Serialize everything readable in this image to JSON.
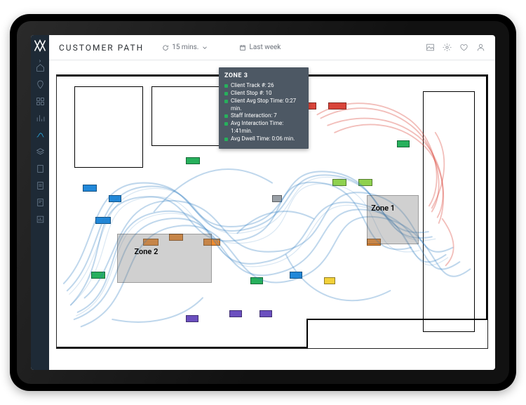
{
  "header": {
    "title": "CUSTOMER PATH",
    "refresh_rate": "15 mins.",
    "date_range": "Last week"
  },
  "sidebar": {
    "items": [
      {
        "name": "home-icon"
      },
      {
        "name": "pin-icon"
      },
      {
        "name": "grid-icon"
      },
      {
        "name": "chart-icon"
      },
      {
        "name": "path-icon",
        "active": true
      },
      {
        "name": "layers-icon"
      },
      {
        "name": "doc-icon"
      },
      {
        "name": "doc2-icon"
      },
      {
        "name": "doc3-icon"
      },
      {
        "name": "report-icon"
      }
    ]
  },
  "tooltip": {
    "title": "ZONE 3",
    "lines": [
      {
        "label": "Client Track #",
        "value": "26"
      },
      {
        "label": "Client Stop #",
        "value": "10"
      },
      {
        "label": "Client Avg Stop Time",
        "value": "0:27 min."
      },
      {
        "label": "Staff Interaction",
        "value": "7"
      },
      {
        "label": "Avg Interaction Time",
        "value": "1:41min."
      },
      {
        "label": "Avg Dwell Time",
        "value": "0:06 min."
      }
    ]
  },
  "zones": {
    "zone1_label": "Zone 1",
    "zone2_label": "Zone 2"
  },
  "colors": {
    "path_customer": "#2b7bbf",
    "path_staff": "#d9443a",
    "sidebar_bg": "#1e2a36",
    "accent": "#2bb0e8"
  }
}
